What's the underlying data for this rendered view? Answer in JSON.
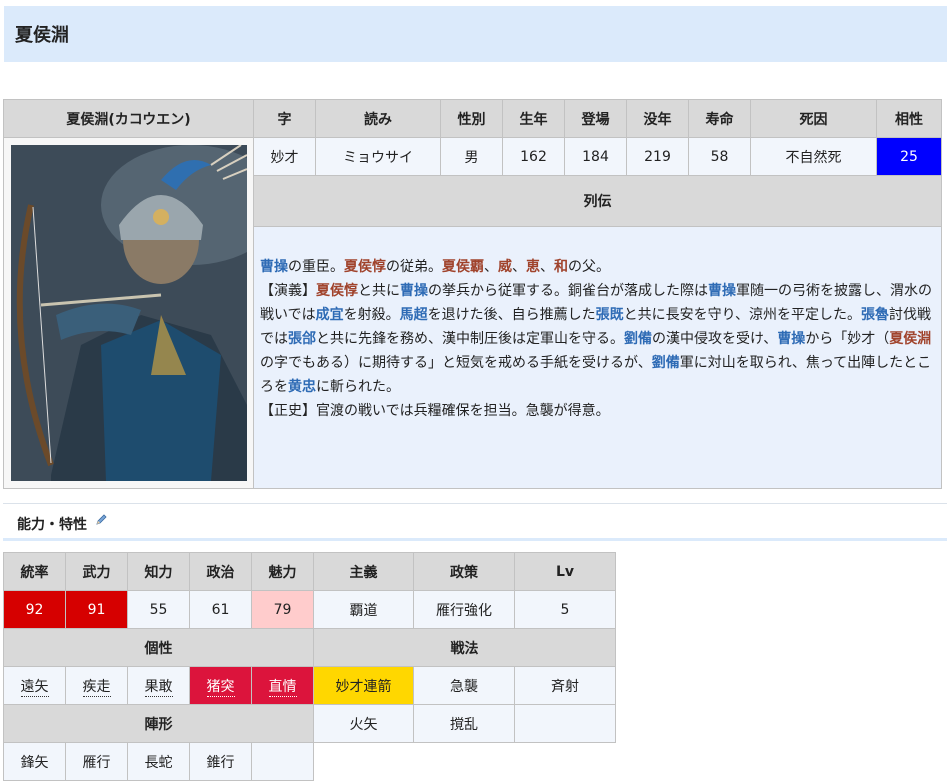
{
  "page_title": "夏侯淵",
  "profile": {
    "headers": [
      "夏侯淵(カコウエン)",
      "字",
      "読み",
      "性別",
      "生年",
      "登場",
      "没年",
      "寿命",
      "死因",
      "相性"
    ],
    "values": [
      "妙才",
      "ミョウサイ",
      "男",
      "162",
      "184",
      "219",
      "58",
      "不自然死",
      "25"
    ],
    "bio_header": "列伝",
    "bio": {
      "l1": [
        "曹操",
        "の重臣。",
        "夏侯惇",
        "の従弟。",
        "夏侯覇",
        "、",
        "威",
        "、",
        "恵",
        "、",
        "和",
        "の父。"
      ],
      "l2": [
        "【演義】",
        "夏侯惇",
        "と共に",
        "曹操",
        "の挙兵から従軍する。銅雀台が落成した際は",
        "曹操",
        "軍随一の弓術を披露し、渭水の戦いでは",
        "成宜",
        "を射殺。",
        "馬超",
        "を退けた後、自ら推薦した",
        "張既",
        "と共に長安を守り、涼州を平定した。",
        "張魯",
        "討伐戦では",
        "張郃",
        "と共に先鋒を務め、漢中制圧後は定軍山を守る。",
        "劉備",
        "の漢中侵攻を受け、",
        "曹操",
        "から「妙才（",
        "夏侯淵",
        "の字でもある）に期待する」と短気を戒める手紙を受けるが、",
        "劉備",
        "軍に対山を取られ、焦って出陣したところを",
        "黄忠",
        "に斬られた。"
      ],
      "l3": "【正史】官渡の戦いでは兵糧確保を担当。急襲が得意。"
    }
  },
  "section": {
    "title": "能力・特性"
  },
  "stats": {
    "headers": [
      "統率",
      "武力",
      "知力",
      "政治",
      "魅力",
      "主義",
      "政策",
      "Lv"
    ],
    "values": [
      "92",
      "91",
      "55",
      "61",
      "79",
      "覇道",
      "雁行強化",
      "5"
    ],
    "traits_header": "個性",
    "tactics_header": "戦法",
    "traits": [
      "遠矢",
      "疾走",
      "果敢",
      "猪突",
      "直情"
    ],
    "tactics_row1": [
      "妙才連箭",
      "急襲",
      "斉射"
    ],
    "formation_header": "陣形",
    "tactics_row2": [
      "火矢",
      "撹乱"
    ],
    "formations": [
      "鋒矢",
      "雁行",
      "長蛇",
      "錐行"
    ]
  },
  "colors": {
    "title_bg": "#dbeafb",
    "affinity_bg": "#0000ff",
    "high_stat": "#d60000",
    "mid_stat": "#ffcccc",
    "trait_red": "#dc143c",
    "unique_tactic": "#ffd700",
    "link": "#2e6bb5",
    "family_link": "#a0432c"
  },
  "icons": {
    "edit": "pencil-icon"
  }
}
